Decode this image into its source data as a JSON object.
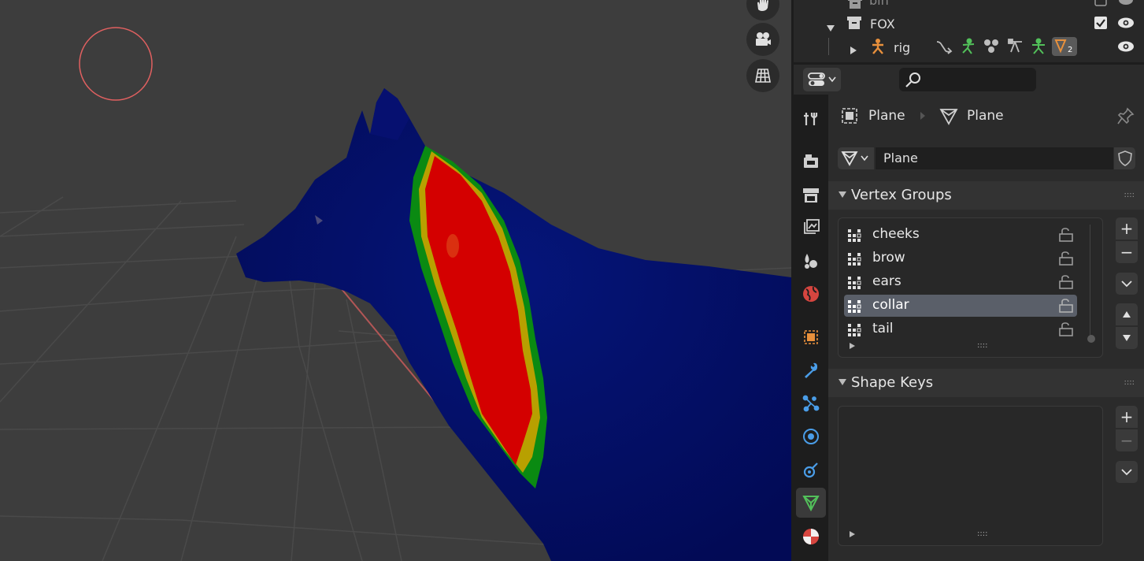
{
  "outliner": {
    "rows": [
      {
        "label": "bin"
      },
      {
        "label": "FOX"
      },
      {
        "label": "rig",
        "badge": "2"
      }
    ]
  },
  "properties": {
    "breadcrumb": {
      "object": "Plane",
      "mesh": "Plane"
    },
    "mesh_name": "Plane",
    "vertex_groups": {
      "title": "Vertex Groups",
      "items": [
        {
          "name": "cheeks",
          "selected": false
        },
        {
          "name": "brow",
          "selected": false
        },
        {
          "name": "ears",
          "selected": false
        },
        {
          "name": "collar",
          "selected": true
        },
        {
          "name": "tail",
          "selected": false
        }
      ]
    },
    "shape_keys": {
      "title": "Shape Keys"
    },
    "buttons": {
      "add": "+",
      "remove": "−"
    },
    "grip": "::::"
  },
  "colors": {
    "accent_selected": "#5a5f69",
    "brush_circle": "#e06060",
    "weight_high": "#d00000",
    "weight_low": "#001177"
  }
}
